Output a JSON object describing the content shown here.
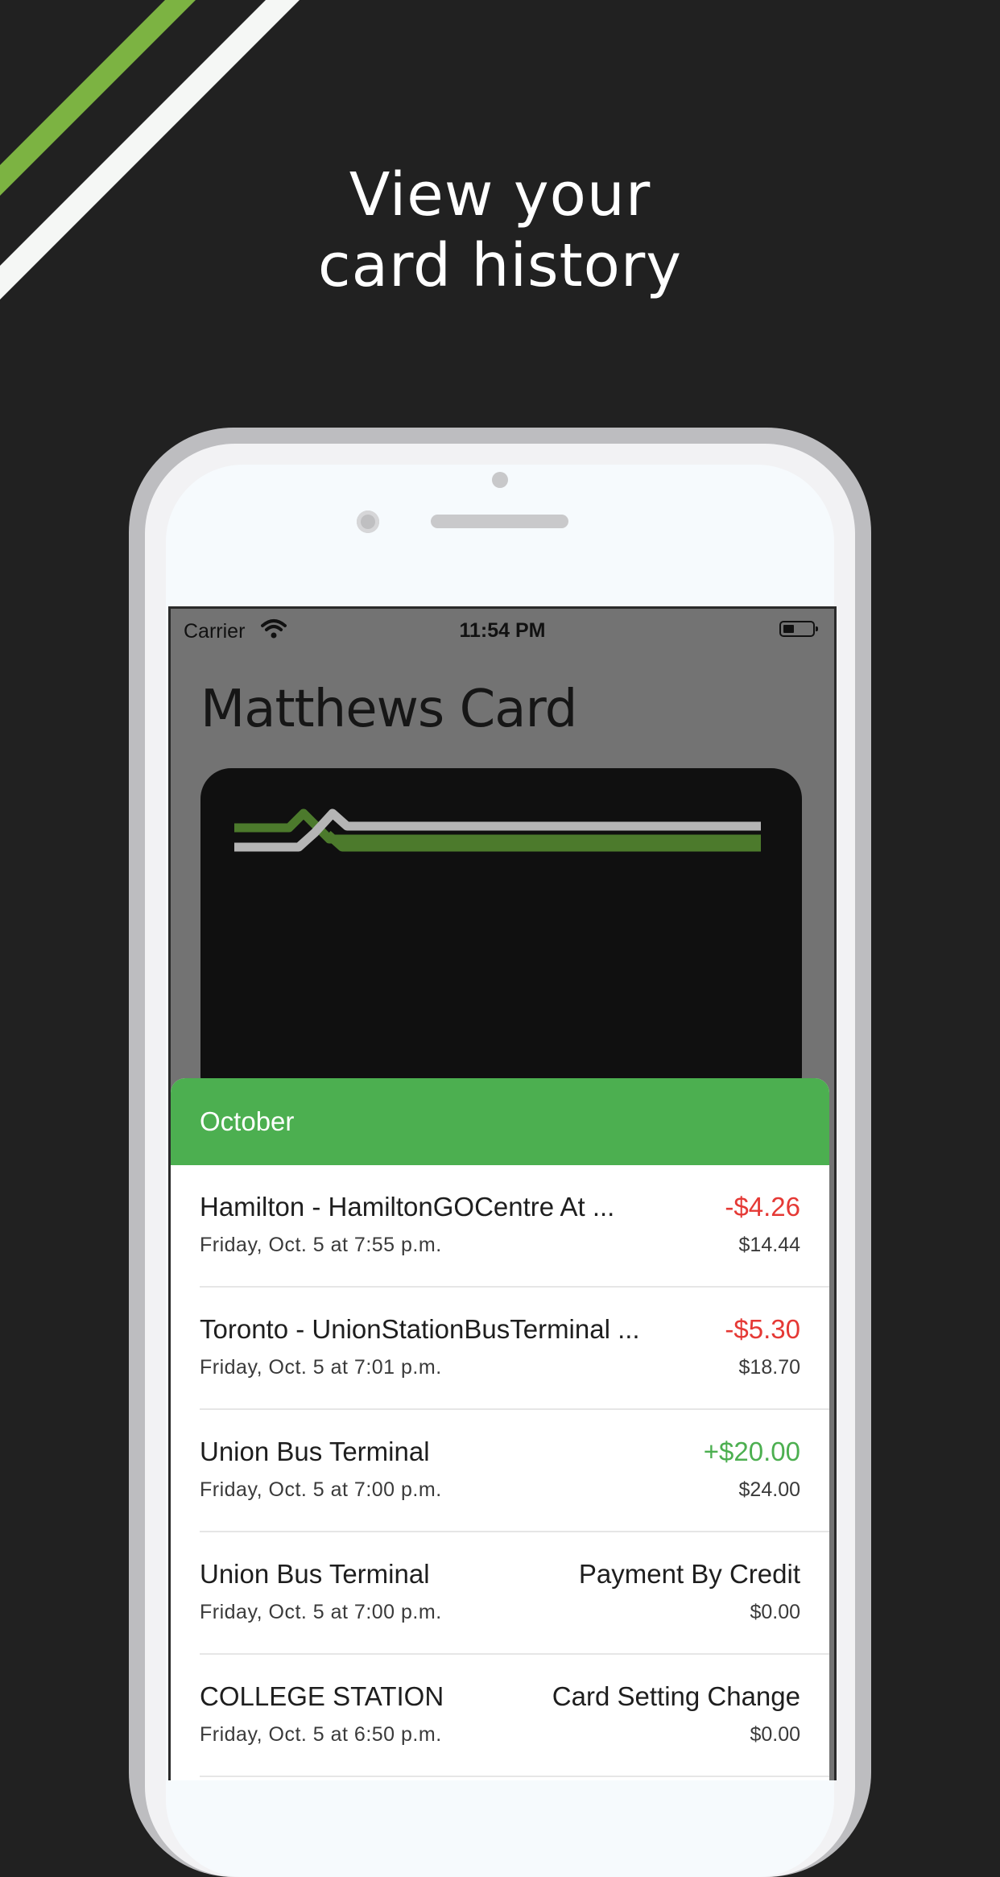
{
  "headline": {
    "line1": "View your",
    "line2": "card history"
  },
  "colors": {
    "background": "#212121",
    "accent_green": "#4caf50",
    "negative": "#e53935",
    "positive": "#4caf50",
    "stripe_green": "#7cb342"
  },
  "status_bar": {
    "carrier": "Carrier",
    "time": "11:54 PM"
  },
  "page": {
    "title": "Matthews Card"
  },
  "history": {
    "month": "October",
    "transactions": [
      {
        "title": "Hamilton - HamiltonGOCentre At ...",
        "date": "Friday, Oct. 5 at 7:55 p.m.",
        "amount": "-$4.26",
        "balance": "$14.44"
      },
      {
        "title": "Toronto - UnionStationBusTerminal ...",
        "date": "Friday, Oct. 5 at 7:01 p.m.",
        "amount": "-$5.30",
        "balance": "$18.70"
      },
      {
        "title": "Union Bus Terminal",
        "date": "Friday, Oct. 5 at 7:00 p.m.",
        "amount": "+$20.00",
        "balance": "$24.00"
      },
      {
        "title": "Union Bus Terminal",
        "date": "Friday, Oct. 5 at 7:00 p.m.",
        "amount": "Payment By Credit",
        "balance": "$0.00"
      },
      {
        "title": "COLLEGE STATION",
        "date": "Friday, Oct. 5 at 6:50 p.m.",
        "amount": "Card Setting Change",
        "balance": "$0.00"
      }
    ]
  }
}
